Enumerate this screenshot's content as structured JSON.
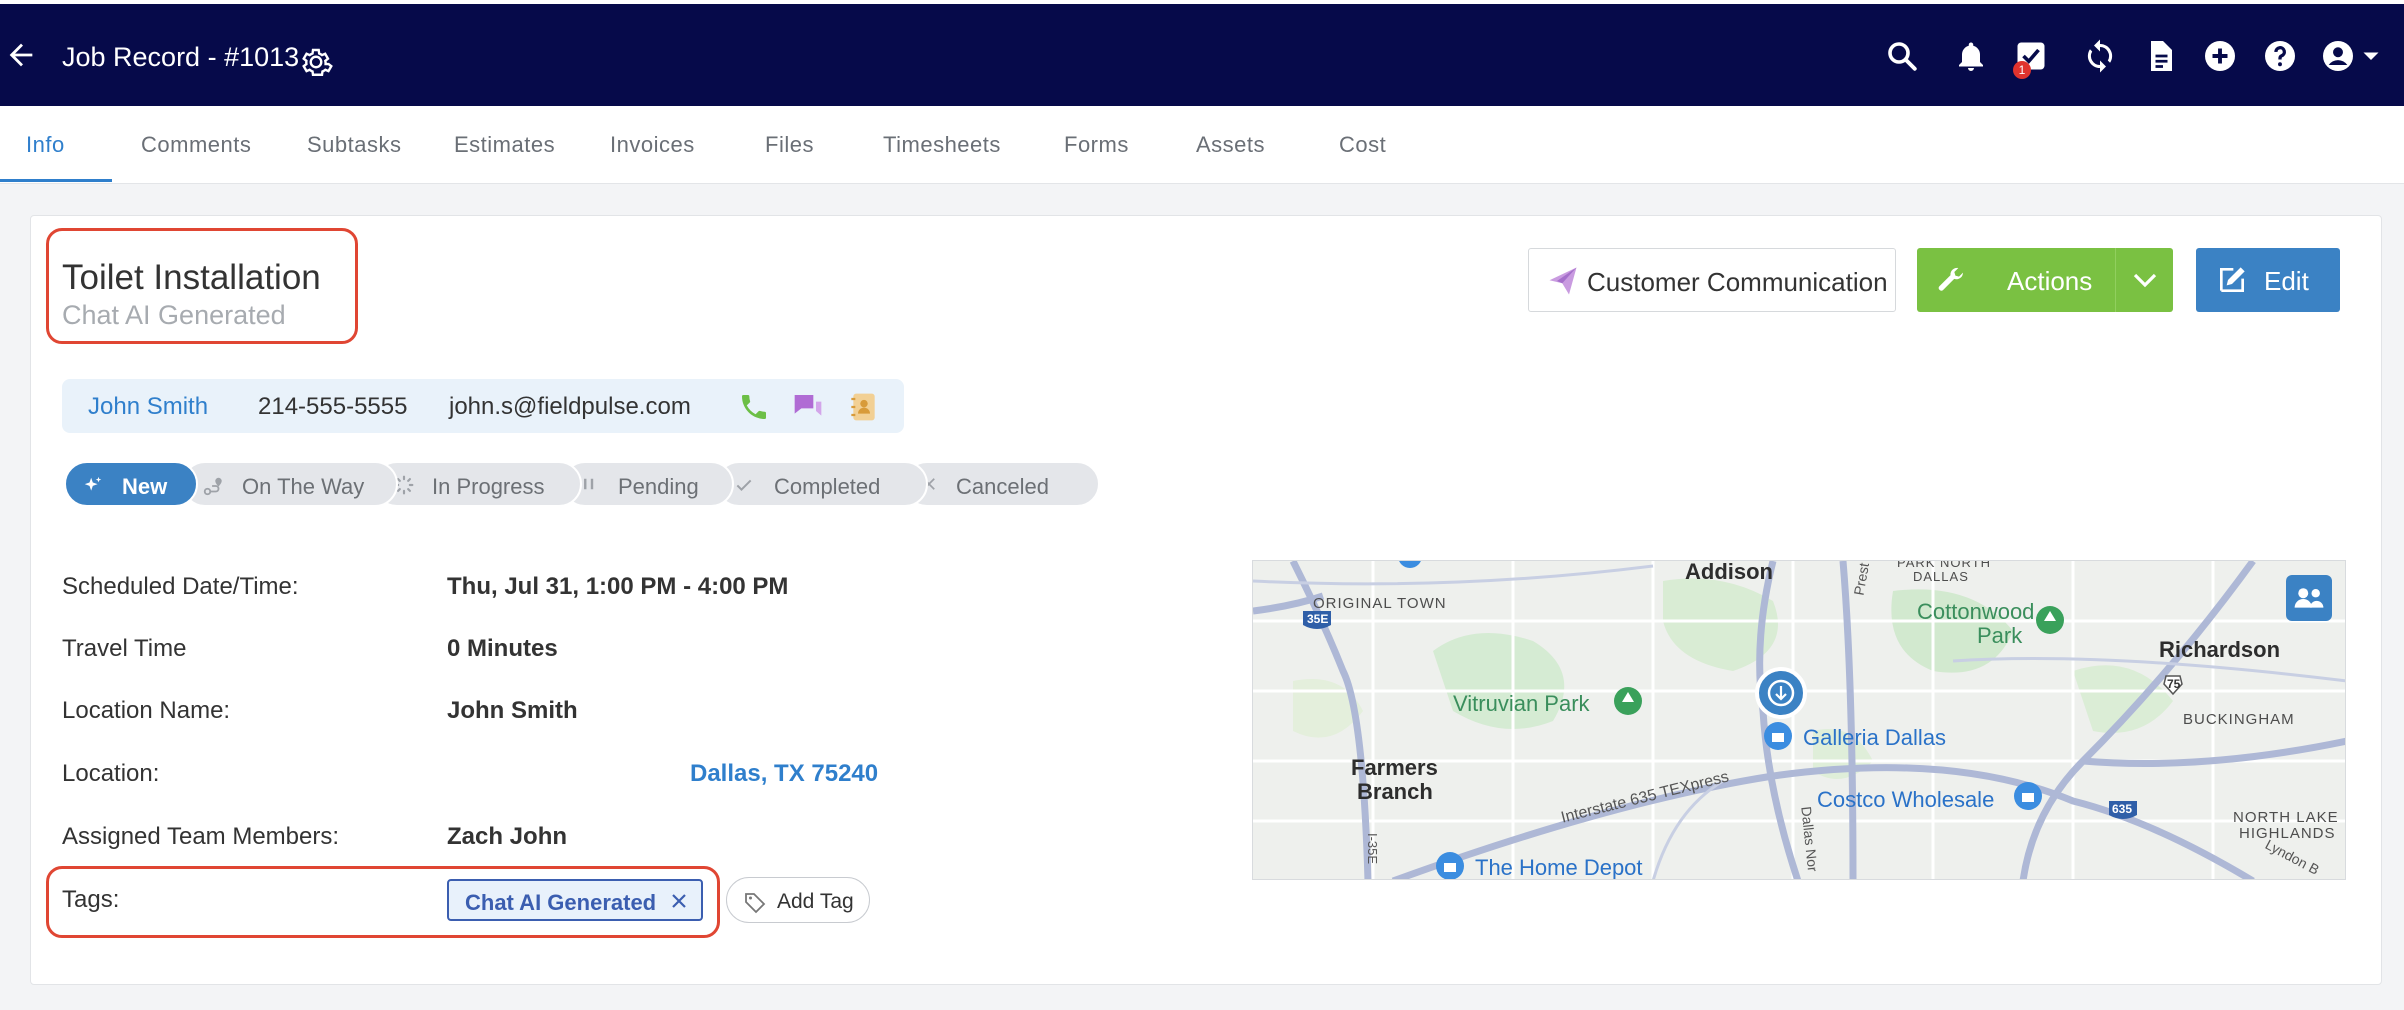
{
  "header": {
    "title": "Job Record - #1013",
    "notification_badge": "1"
  },
  "tabs": [
    "Info",
    "Comments",
    "Subtasks",
    "Estimates",
    "Invoices",
    "Files",
    "Timesheets",
    "Forms",
    "Assets",
    "Cost"
  ],
  "job": {
    "title": "Toilet Installation",
    "subtitle": "Chat AI Generated"
  },
  "buttons": {
    "customer_communication": "Customer Communication",
    "actions": "Actions",
    "edit": "Edit"
  },
  "contact": {
    "name": "John Smith",
    "phone": "214-555-5555",
    "email": "john.s@fieldpulse.com"
  },
  "statuses": [
    "New",
    "On The Way",
    "In Progress",
    "Pending",
    "Completed",
    "Canceled"
  ],
  "fields": {
    "scheduled_label": "Scheduled Date/Time:",
    "scheduled_value": "Thu, Jul 31, 1:00 PM - 4:00 PM",
    "travel_label": "Travel Time",
    "travel_value": "0 Minutes",
    "location_name_label": "Location Name:",
    "location_name_value": "John Smith",
    "location_label": "Location:",
    "location_value": "Dallas, TX 75240",
    "team_label": "Assigned Team Members:",
    "team_value": "Zach John",
    "tags_label": "Tags:"
  },
  "tags": {
    "items": [
      "Chat AI Generated"
    ],
    "add_label": "Add Tag"
  },
  "map": {
    "labels": {
      "addison": "Addison",
      "original_town": "ORIGINAL TOWN",
      "park_north": "PARK NORTH",
      "dallas_small": "DALLAS",
      "prest": "Prest",
      "cottonwood": "Cottonwood",
      "park": "Park",
      "richardson": "Richardson",
      "vitruvian": "Vitruvian Park",
      "galleria": "Galleria Dallas",
      "buckingham": "BUCKINGHAM",
      "farmers": "Farmers",
      "branch": "Branch",
      "interstate": "Interstate 635 TEXpress",
      "costco": "Costco Wholesale",
      "north_lake": "NORTH LAKE",
      "highlands": "HIGHLANDS",
      "home_depot": "The Home Depot",
      "i35e": "I-35E",
      "dallas_nor": "Dallas Nor",
      "lyndon": "Lyndon B",
      "shield_35e": "35E",
      "shield_75": "75",
      "shield_635": "635"
    }
  },
  "colors": {
    "header_bg": "#060a4a",
    "accent_blue": "#3b82c4",
    "actions_green": "#7ac142",
    "highlight_red": "#e04633"
  }
}
